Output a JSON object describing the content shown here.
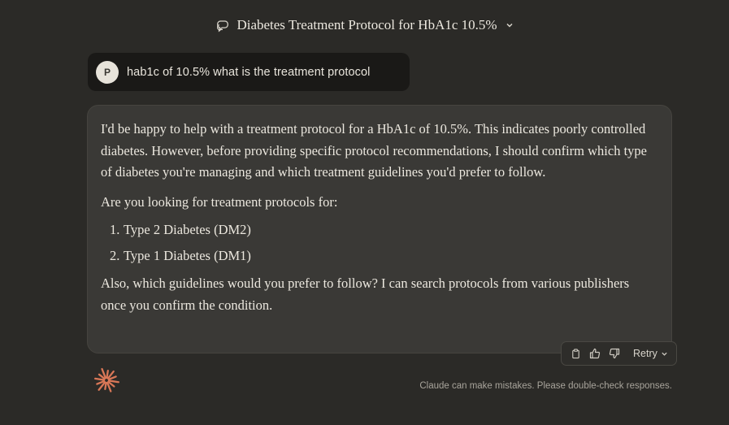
{
  "header": {
    "title": "Diabetes Treatment Protocol for HbA1c 10.5%"
  },
  "user_message": {
    "avatar_initial": "P",
    "text": "hab1c of 10.5% what is the treatment protocol"
  },
  "assistant_message": {
    "paragraph1": "I'd be happy to help with a treatment protocol for a HbA1c of 10.5%. This indicates poorly controlled diabetes. However, before providing specific protocol recommendations, I should confirm which type of diabetes you're managing and which treatment guidelines you'd prefer to follow.",
    "paragraph2": "Are you looking for treatment protocols for:",
    "list": [
      {
        "num": "1.",
        "text": "Type 2 Diabetes (DM2)"
      },
      {
        "num": "2.",
        "text": "Type 1 Diabetes (DM1)"
      }
    ],
    "paragraph3": "Also, which guidelines would you prefer to follow? I can search protocols from various publishers once you confirm the condition."
  },
  "actions": {
    "retry_label": "Retry",
    "icons": [
      "copy-icon",
      "thumbs-up-icon",
      "thumbs-down-icon",
      "chevron-down-icon"
    ]
  },
  "footer": {
    "disclaimer": "Claude can make mistakes. Please double-check responses."
  },
  "colors": {
    "background": "#2b2a27",
    "assistant_bubble": "#3a3936",
    "user_bubble": "#1a1917",
    "logo_accent": "#d97757"
  }
}
